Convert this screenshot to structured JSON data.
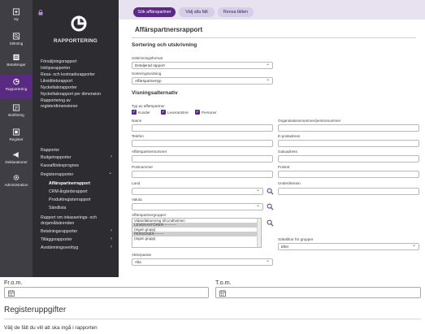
{
  "rail": [
    {
      "label": "Ny",
      "icon": "plus-icon"
    },
    {
      "label": "Sökning",
      "icon": "search-icon"
    },
    {
      "label": "Betalningar",
      "icon": "payments-icon"
    },
    {
      "label": "Rapportering",
      "icon": "report-icon"
    },
    {
      "label": "Bokföring",
      "icon": "ledger-icon"
    },
    {
      "label": "Register",
      "icon": "register-icon"
    },
    {
      "label": "Deklarationer",
      "icon": "megaphone-icon"
    },
    {
      "label": "Administration",
      "icon": "gear-icon"
    }
  ],
  "menu": {
    "title": "RAPPORTERING",
    "group1": [
      "Försäljningsrapport",
      "Inköpsrapporter",
      "Resa- och kostnadsrapporter",
      "Likviditetsrapport",
      "Nyckeltalsrapporter",
      "Nyckeltalsrapport per dimension",
      "Rapportering av",
      "registerdimensioner"
    ],
    "group2": [
      {
        "label": "Rapporter",
        "chev": ""
      },
      {
        "label": "Budgetrapporter",
        "chev": "›"
      },
      {
        "label": "Kassaflödesprognos",
        "chev": ""
      },
      {
        "label": "Registerrapporter",
        "chev": "⌄"
      }
    ],
    "sub": [
      "Affärspartnerrapport",
      "CRM-årgärdsrapport",
      "Produktregisterrapport",
      "Sändlista"
    ],
    "group3": [
      {
        "label": "Rapport om inkasserings- och",
        "chev": ""
      },
      {
        "label": "drojsmålsärenden",
        "chev": ""
      },
      {
        "label": "Betalningsrapporter",
        "chev": "›"
      },
      {
        "label": "Tilläggsrapporter",
        "chev": "›"
      },
      {
        "label": "Avstämningsverktyg",
        "chev": "›"
      }
    ]
  },
  "toolbar": {
    "search": "Sök affärspartner",
    "select_all": "Välj alla fält",
    "clear": "Rensa fälten"
  },
  "form": {
    "title": "Affärspartnersrapport",
    "sort_section": "Sortering och utskrivning",
    "print_format_label": "Utskrivningsformat",
    "print_format_value": "Detaljerad rapport",
    "sort_order_label": "Sorteringsordning",
    "sort_order_value": "Affärspartnertyp",
    "view_section": "Visningsalternativ",
    "type_label": "Typ av affärspartner",
    "types": [
      "Kunder",
      "Leverantörer",
      "Personer"
    ],
    "name_label": "Namn",
    "org_label": "Organisationsnummer/personnummer",
    "phone_label": "Telefon",
    "email_label": "E-postadress",
    "bpnum_label": "Affärspartnernummer",
    "street_label": "Gatuadress",
    "zip_label": "Postnummer",
    "city_label": "Postort",
    "country_label": "Land",
    "subdivision_label": "Underdivision",
    "currency_label": "Valuta",
    "groups_label": "Affärspartnergrupper",
    "groups_options": [
      "Vidarefakturering till Lindholmen",
      "LEVERANTÖRER-----------",
      "(Ingen grupp)",
      "PERSONER--------",
      "(Ingen grupp)"
    ],
    "conditions_label": "Sökvillkor för grupper",
    "conditions_value": "Eller",
    "active_label": "Aktiv/passiv",
    "active_value": "Alla"
  },
  "lower": {
    "from_label": "Fr.o.m.",
    "to_label": "T.o.m.",
    "register_title": "Registeruppgifter",
    "register_sub": "Välj de fält du vill att ska ingå i rapporten"
  },
  "colors": {
    "accent": "#5b2a86",
    "rail": "#3e3e44",
    "menu": "#2d2d31",
    "toolbar": "#e7e1f0"
  }
}
